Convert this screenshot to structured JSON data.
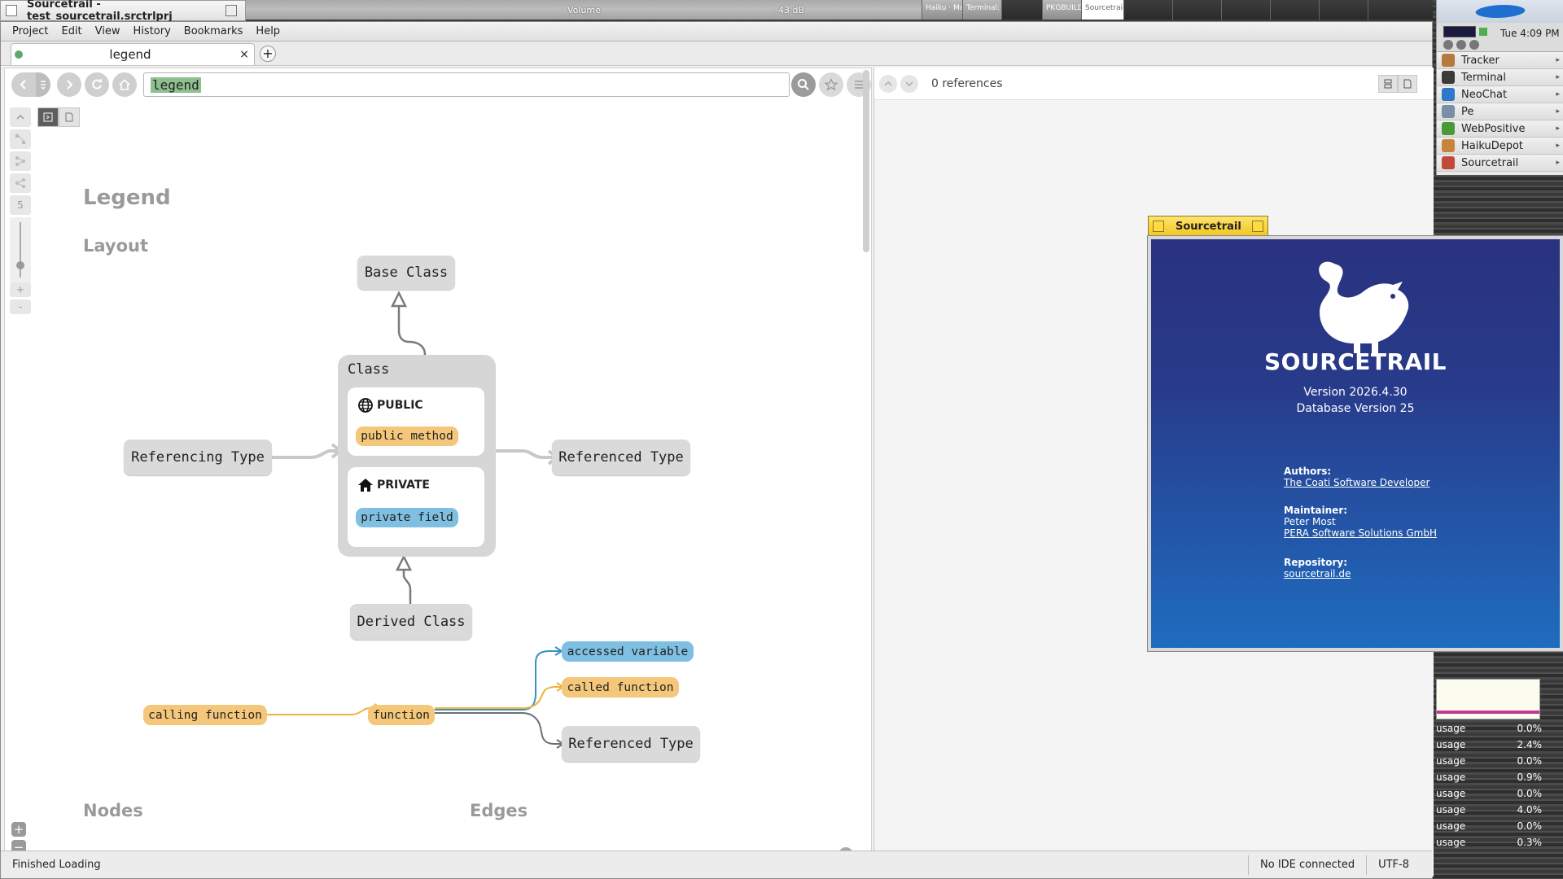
{
  "window": {
    "title": "Sourcetrail - test_sourcetrail.srctrlprj"
  },
  "taskbar": {
    "volume_label": "Volume",
    "volume_db": "-43 dB",
    "items": [
      "Haiku · Mai…",
      "Terminal: h…",
      "PKGBUILD…",
      "Sourcetrail"
    ]
  },
  "deskbar": {
    "clock": "Tue 4:09 PM",
    "apps": [
      {
        "label": "Tracker",
        "color": "#b57a3c"
      },
      {
        "label": "Terminal",
        "color": "#3a3a3a"
      },
      {
        "label": "NeoChat",
        "color": "#2e78c7"
      },
      {
        "label": "Pe",
        "color": "#7a8ea8"
      },
      {
        "label": "WebPositive",
        "color": "#4a9a3a"
      },
      {
        "label": "HaikuDepot",
        "color": "#c8843a"
      },
      {
        "label": "Sourcetrail",
        "color": "#c24a3a"
      }
    ]
  },
  "cpu_monitor": [
    {
      "label": "usage",
      "value": "0.0%"
    },
    {
      "label": "usage",
      "value": "2.4%"
    },
    {
      "label": "usage",
      "value": "0.0%"
    },
    {
      "label": "usage",
      "value": "0.9%"
    },
    {
      "label": "usage",
      "value": "0.0%"
    },
    {
      "label": "usage",
      "value": "4.0%"
    },
    {
      "label": "usage",
      "value": "0.0%"
    },
    {
      "label": "usage",
      "value": "0.3%"
    }
  ],
  "menu": [
    "Project",
    "Edit",
    "View",
    "History",
    "Bookmarks",
    "Help"
  ],
  "tab": {
    "label": "legend",
    "close": "×",
    "add": "+"
  },
  "search": {
    "query": "legend"
  },
  "graph": {
    "zoom_level": "5",
    "legend_title": "Legend",
    "layout_heading": "Layout",
    "nodes_heading": "Nodes",
    "edges_heading": "Edges",
    "base_class": "Base Class",
    "class_title": "Class",
    "public_label": "PUBLIC",
    "public_method": "public method",
    "private_label": "PRIVATE",
    "private_field": "private field",
    "referencing_type": "Referencing Type",
    "referenced_type": "Referenced Type",
    "derived_class": "Derived Class",
    "calling_function": "calling function",
    "function": "function",
    "accessed_variable": "accessed variable",
    "called_function": "called function",
    "referenced_type_2": "Referenced Type",
    "help": "?"
  },
  "references": {
    "count_text": "0 references"
  },
  "status": {
    "message": "Finished Loading",
    "ide": "No IDE connected",
    "encoding": "UTF-8"
  },
  "about": {
    "window_title": "Sourcetrail",
    "brand": "SOURCETRAIL",
    "version": "Version 2026.4.30",
    "db_version": "Database Version 25",
    "authors_label": "Authors:",
    "authors": "The Coati Software Developer",
    "maintainer_label": "Maintainer:",
    "maintainer": "Peter Most",
    "maintainer_company": "PERA Software Solutions GmbH",
    "repository_label": "Repository:",
    "repository": "sourcetrail.de"
  },
  "colors": {
    "accent_yellow": "#f4c77a",
    "accent_blue": "#7fbfe2",
    "about_gradient_top": "#29327f",
    "about_gradient_bottom": "#1f6cbf"
  }
}
